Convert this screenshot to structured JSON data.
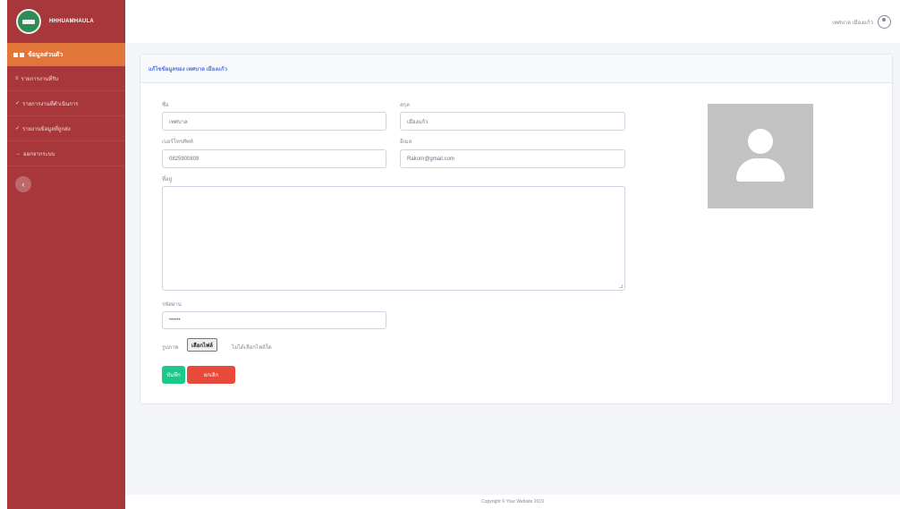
{
  "brand": {
    "name": "HHHUAMHAULA"
  },
  "sidebar": {
    "active_item": "ข้อมูลส่วนตัว",
    "items": [
      {
        "label": "รายการงานที่รับ",
        "icon": "list-icon"
      },
      {
        "label": "รายการงานที่ดำเนินการ",
        "icon": "check-icon"
      },
      {
        "label": "รายงานข้อมูลที่ถูกส่ง",
        "icon": "check-icon"
      },
      {
        "label": "ออกจากระบบ",
        "icon": "logout-icon"
      }
    ],
    "toggle_icon": "chevron-left-icon"
  },
  "topbar": {
    "user_name": "เทศบาล เมืองแก้ว"
  },
  "card": {
    "title": "แก้ไขข้อมูลของ เทศบาล เมืองแก้ว"
  },
  "form": {
    "first_name_label": "ชื่อ",
    "first_name_value": "เทศบาล",
    "last_name_label": "สกุล",
    "last_name_value": "เมืองแก้ว",
    "phone_label": "เบอร์โทรศัพท์",
    "phone_value": "0825900809",
    "email_label": "อีเมล",
    "email_value": "Rakorn@gmail.com",
    "address_label": "ที่อยู่",
    "address_value": "",
    "password_label": "รหัสผ่าน",
    "password_value": "••••••",
    "image_label": "รูปภาพ",
    "file_button": "เลือกไฟล์",
    "file_status": "ไม่ได้เลือกไฟล์ใด",
    "save_button": "บันทึก",
    "cancel_button": "ยกเลิก"
  },
  "footer": {
    "text": "Copyright © Your Website 2019"
  },
  "colors": {
    "sidebar": "#a7373a",
    "active": "#e2753a",
    "save": "#1cc88a",
    "cancel": "#e74a3b",
    "accent": "#4e73df"
  }
}
